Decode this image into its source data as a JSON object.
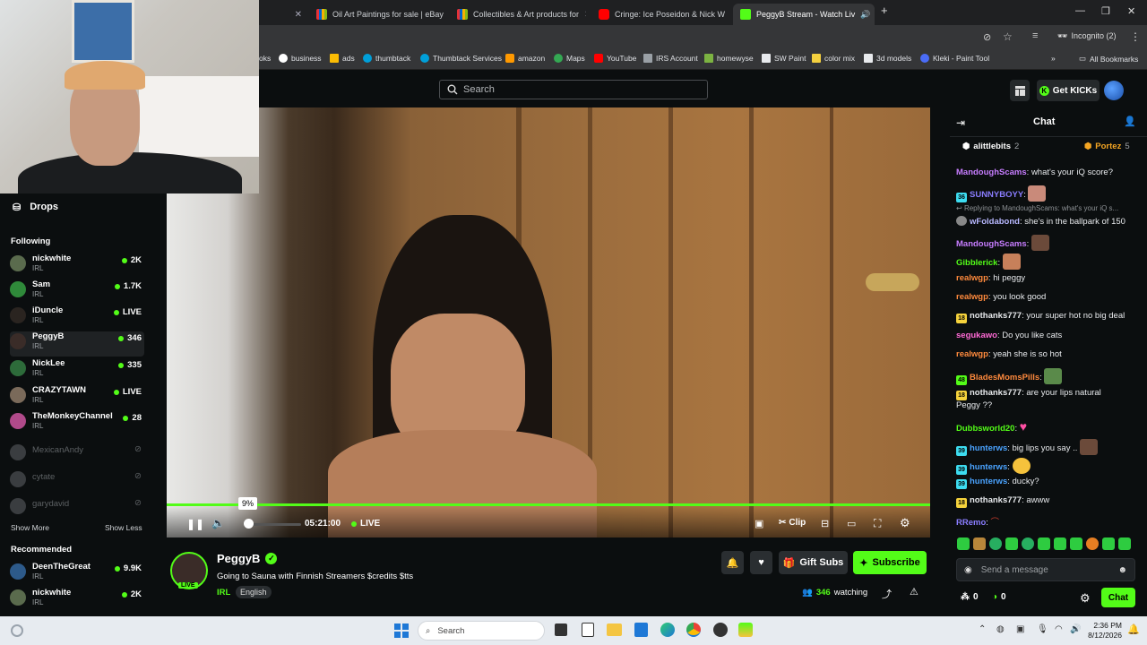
{
  "browser": {
    "tabs": [
      {
        "title": "Oil Art Paintings for sale | eBay"
      },
      {
        "title": "Collectibles & Art products for"
      },
      {
        "title": "Cringe: Ice Poseidon & Nick W"
      },
      {
        "title": "PeggyB Stream - Watch Liv"
      }
    ],
    "new_tab": "+",
    "profile": "Incognito (2)",
    "bookmarks": [
      "oks",
      "business",
      "ads",
      "thumbtack",
      "Thumbtack Services",
      "amazon",
      "Maps",
      "YouTube",
      "IRS Account",
      "homewyse",
      "SW Paint",
      "color mix",
      "3d models",
      "Kleki - Paint Tool"
    ],
    "all_bookmarks": "All Bookmarks"
  },
  "header": {
    "search_placeholder": "Search",
    "get_kicks": "Get KICKs"
  },
  "sidebar": {
    "drops": "Drops",
    "following_title": "Following",
    "following": [
      {
        "name": "nickwhite",
        "category": "IRL",
        "viewers": "2K"
      },
      {
        "name": "Sam",
        "category": "IRL",
        "viewers": "1.7K"
      },
      {
        "name": "iDuncle",
        "category": "IRL",
        "viewers": "LIVE"
      },
      {
        "name": "PeggyB",
        "category": "IRL",
        "viewers": "346"
      },
      {
        "name": "NickLee",
        "category": "IRL",
        "viewers": "335"
      },
      {
        "name": "CRAZYTAWN",
        "category": "IRL",
        "viewers": "LIVE"
      },
      {
        "name": "TheMonkeyChannel",
        "category": "IRL",
        "viewers": "28"
      }
    ],
    "offline": [
      "MexicanAndy",
      "cytate",
      "garydavid"
    ],
    "show_more": "Show More",
    "show_less": "Show Less",
    "recommended_title": "Recommended",
    "recommended": [
      {
        "name": "DeenTheGreat",
        "category": "IRL",
        "viewers": "9.9K"
      },
      {
        "name": "nickwhite",
        "category": "IRL",
        "viewers": "2K"
      }
    ]
  },
  "player": {
    "tooltip": "9%",
    "time": "05:21:00",
    "live": "LIVE",
    "clip": "Clip",
    "progress": 1.0,
    "volume_fraction": 0.09
  },
  "stream": {
    "streamer": "PeggyB",
    "live_badge": "LIVE",
    "title": "Going to Sauna with Finnish Streamers $credits $tts",
    "category": "IRL",
    "language": "English",
    "gift_subs": "Gift Subs",
    "subscribe": "Subscribe",
    "watching_count": "346",
    "watching_label": "watching"
  },
  "chat": {
    "title": "Chat",
    "gifters": [
      {
        "name": "alittlebits",
        "count": "2"
      },
      {
        "name": "Portez",
        "count": "5"
      }
    ],
    "messages": [
      {
        "user": "MandoughScams",
        "text": "what's your iQ score?",
        "color": "#c77dff"
      },
      {
        "user": "SUNNYBOYY",
        "text": "",
        "color": "#8a7dff"
      },
      {
        "reply": "Replying to MandoughScams: what's your iQ s..."
      },
      {
        "user": "wFoldabond",
        "text": "she's in the ballpark of 150",
        "color": "#b8b8ff"
      },
      {
        "user": "MandoughScams",
        "text": "",
        "color": "#c77dff"
      },
      {
        "user": "Gibblerick",
        "text": "",
        "color": "#53fc18"
      },
      {
        "user": "realwgp",
        "text": "hi peggy",
        "color": "#ff8a3d"
      },
      {
        "user": "realwgp",
        "text": "you look good",
        "color": "#ff8a3d"
      },
      {
        "user": "nothanks777",
        "text": "your super hot no big deal",
        "color": "#ffffff"
      },
      {
        "user": "segukawo",
        "text": "Do you like cats",
        "color": "#ff6ad5"
      },
      {
        "user": "realwgp",
        "text": "yeah she is so hot",
        "color": "#ff8a3d"
      },
      {
        "user": "BladesMomsPills",
        "text": "",
        "color": "#ff8a3d"
      },
      {
        "user": "nothanks777",
        "text": "are your lips natural",
        "cont": "Peggy ??",
        "color": "#ffffff"
      },
      {
        "user": "Dubbsworld20",
        "text": "",
        "color": "#53fc18"
      },
      {
        "user": "hunterws",
        "text": "big lips you say ..",
        "color": "#4aa3ff"
      },
      {
        "user": "hunterws",
        "text": "",
        "color": "#4aa3ff"
      },
      {
        "user": "hunterws",
        "text": "ducky?",
        "color": "#4aa3ff"
      },
      {
        "user": "nothanks777",
        "text": "awww",
        "color": "#ffffff"
      },
      {
        "user": "RRemo",
        "text": "",
        "color": "#8a7dff"
      }
    ],
    "input_placeholder": "Send a message",
    "points_a": "0",
    "points_b": "0",
    "send": "Chat"
  },
  "taskbar": {
    "search": "Search",
    "time": "2:36 PM",
    "date": "8/12/2026"
  },
  "colors": {
    "accent": "#53fc18",
    "bg": "#0b0e0f"
  }
}
